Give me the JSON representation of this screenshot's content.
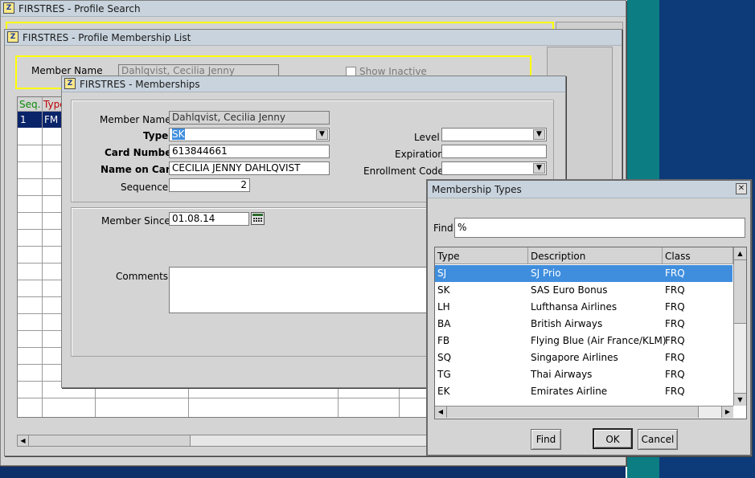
{
  "windows": {
    "profile_search": {
      "title": "FIRSTRES - Profile Search"
    },
    "membership_list": {
      "title": "FIRSTRES - Profile Membership List",
      "member_name_label": "Member Name",
      "member_name_value": "Dahlqvist, Cecilia Jenny",
      "show_inactive_label": "Show Inactive",
      "columns": [
        "Seq.",
        "Type"
      ],
      "first_row": {
        "seq": "1",
        "type": "FM"
      }
    },
    "memberships": {
      "title": "FIRSTRES - Memberships",
      "member_name_label": "Member Name",
      "member_name_value": "Dahlqvist, Cecilia Jenny",
      "type_label": "Type",
      "type_value": "SK",
      "card_number_label": "Card Number",
      "card_number_value": "613844661",
      "name_on_card_label": "Name on Card",
      "name_on_card_value": "CECILIA JENNY DAHLQVIST",
      "sequence_label": "Sequence",
      "sequence_value": "2",
      "level_label": "Level",
      "expiration_label": "Expiration",
      "enrollment_code_label": "Enrollment Code",
      "member_since_label": "Member Since",
      "member_since_value": "01.08.14",
      "comments_label": "Comments"
    },
    "membership_types": {
      "title": "Membership Types",
      "close_glyph": "✕",
      "find_label": "Find",
      "find_value": "%",
      "columns": [
        "Type",
        "Description",
        "Class"
      ],
      "rows": [
        {
          "type": "SJ",
          "description": "SJ Prio",
          "class": "FRQ"
        },
        {
          "type": "SK",
          "description": "SAS Euro Bonus",
          "class": "FRQ"
        },
        {
          "type": "LH",
          "description": "Lufthansa Airlines",
          "class": "FRQ"
        },
        {
          "type": "BA",
          "description": "British Airways",
          "class": "FRQ"
        },
        {
          "type": "FB",
          "description": "Flying Blue (Air France/KLM)",
          "class": "FRQ"
        },
        {
          "type": "SQ",
          "description": "Singapore Airlines",
          "class": "FRQ"
        },
        {
          "type": "TG",
          "description": "Thai Airways",
          "class": "FRQ"
        },
        {
          "type": "EK",
          "description": "Emirates Airline",
          "class": "FRQ"
        }
      ],
      "buttons": {
        "find": "Find",
        "ok": "OK",
        "cancel": "Cancel"
      }
    }
  },
  "icons": {
    "app": "app-icon",
    "dropdown": "dropdown-arrow-icon",
    "calendar": "calendar-icon",
    "close": "close-icon",
    "scroll_up": "scroll-up-icon",
    "scroll_down": "scroll-down-icon",
    "scroll_left": "scroll-left-icon",
    "scroll_right": "scroll-right-icon"
  },
  "colors": {
    "desktop": "#0d2f6a",
    "teal": "#0c7d83",
    "highlight": "#3f8ede",
    "selected_row": "#0a246a",
    "title_bar": "#c8d3dd",
    "required_border": "#ffff00"
  }
}
